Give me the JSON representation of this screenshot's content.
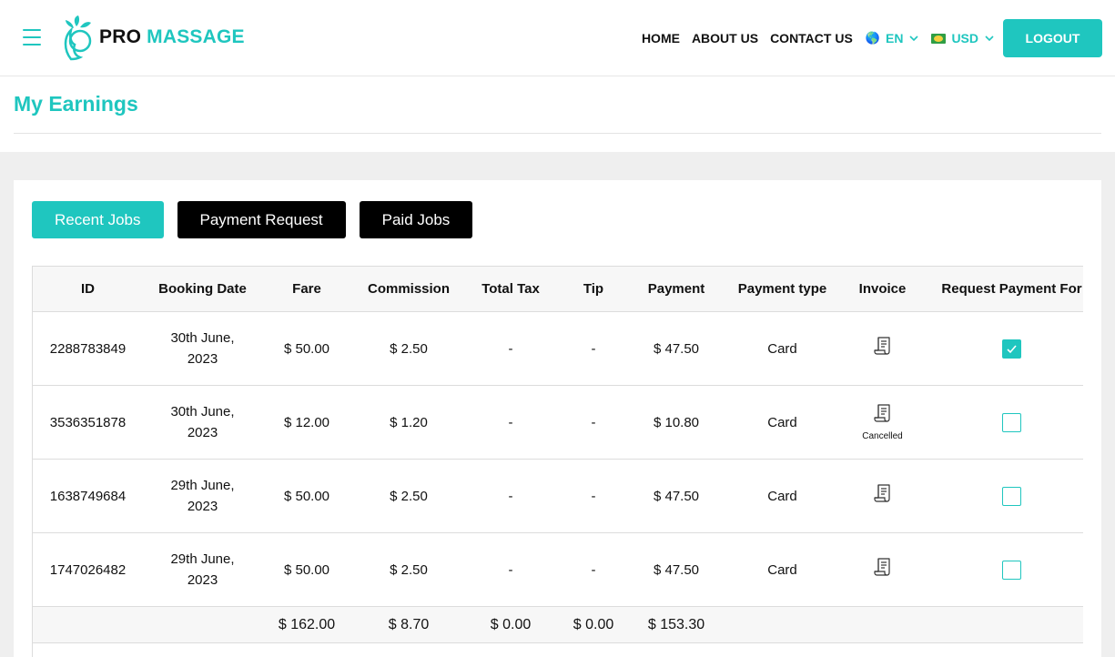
{
  "brand": {
    "name_part1": "PRO",
    "name_part2": "MASSAGE",
    "accent": "#1fc6bf"
  },
  "nav": {
    "home": "HOME",
    "about": "ABOUT US",
    "contact": "CONTACT US",
    "language": "EN",
    "currency": "USD",
    "logout": "LOGOUT"
  },
  "page": {
    "title": "My Earnings"
  },
  "tabs": [
    {
      "label": "Recent Jobs",
      "active": true
    },
    {
      "label": "Payment Request",
      "active": false
    },
    {
      "label": "Paid Jobs",
      "active": false
    }
  ],
  "table": {
    "headers": [
      "ID",
      "Booking Date",
      "Fare",
      "Commission",
      "Total Tax",
      "Tip",
      "Payment",
      "Payment type",
      "Invoice",
      "Request Payment For"
    ],
    "rows": [
      {
        "id": "2288783849",
        "date1": "30th June,",
        "date2": "2023",
        "fare": "$ 50.00",
        "commission": "$ 2.50",
        "tax": "-",
        "tip": "-",
        "payment": "$ 47.50",
        "type": "Card",
        "invoice_note": "",
        "checked": true
      },
      {
        "id": "3536351878",
        "date1": "30th June,",
        "date2": "2023",
        "fare": "$ 12.00",
        "commission": "$ 1.20",
        "tax": "-",
        "tip": "-",
        "payment": "$ 10.80",
        "type": "Card",
        "invoice_note": "Cancelled",
        "checked": false
      },
      {
        "id": "1638749684",
        "date1": "29th June,",
        "date2": "2023",
        "fare": "$ 50.00",
        "commission": "$ 2.50",
        "tax": "-",
        "tip": "-",
        "payment": "$ 47.50",
        "type": "Card",
        "invoice_note": "",
        "checked": false
      },
      {
        "id": "1747026482",
        "date1": "29th June,",
        "date2": "2023",
        "fare": "$ 50.00",
        "commission": "$ 2.50",
        "tax": "-",
        "tip": "-",
        "payment": "$ 47.50",
        "type": "Card",
        "invoice_note": "",
        "checked": false
      }
    ],
    "totals": {
      "fare": "$ 162.00",
      "commission": "$ 8.70",
      "tax": "$ 0.00",
      "tip": "$ 0.00",
      "payment": "$ 153.30"
    }
  },
  "icons": {
    "menu": "hamburger-icon",
    "language": "globe-icon",
    "currency": "flag-icon",
    "dropdown": "chevron-down-icon",
    "invoice": "receipt-icon",
    "check": "checkmark-icon"
  }
}
